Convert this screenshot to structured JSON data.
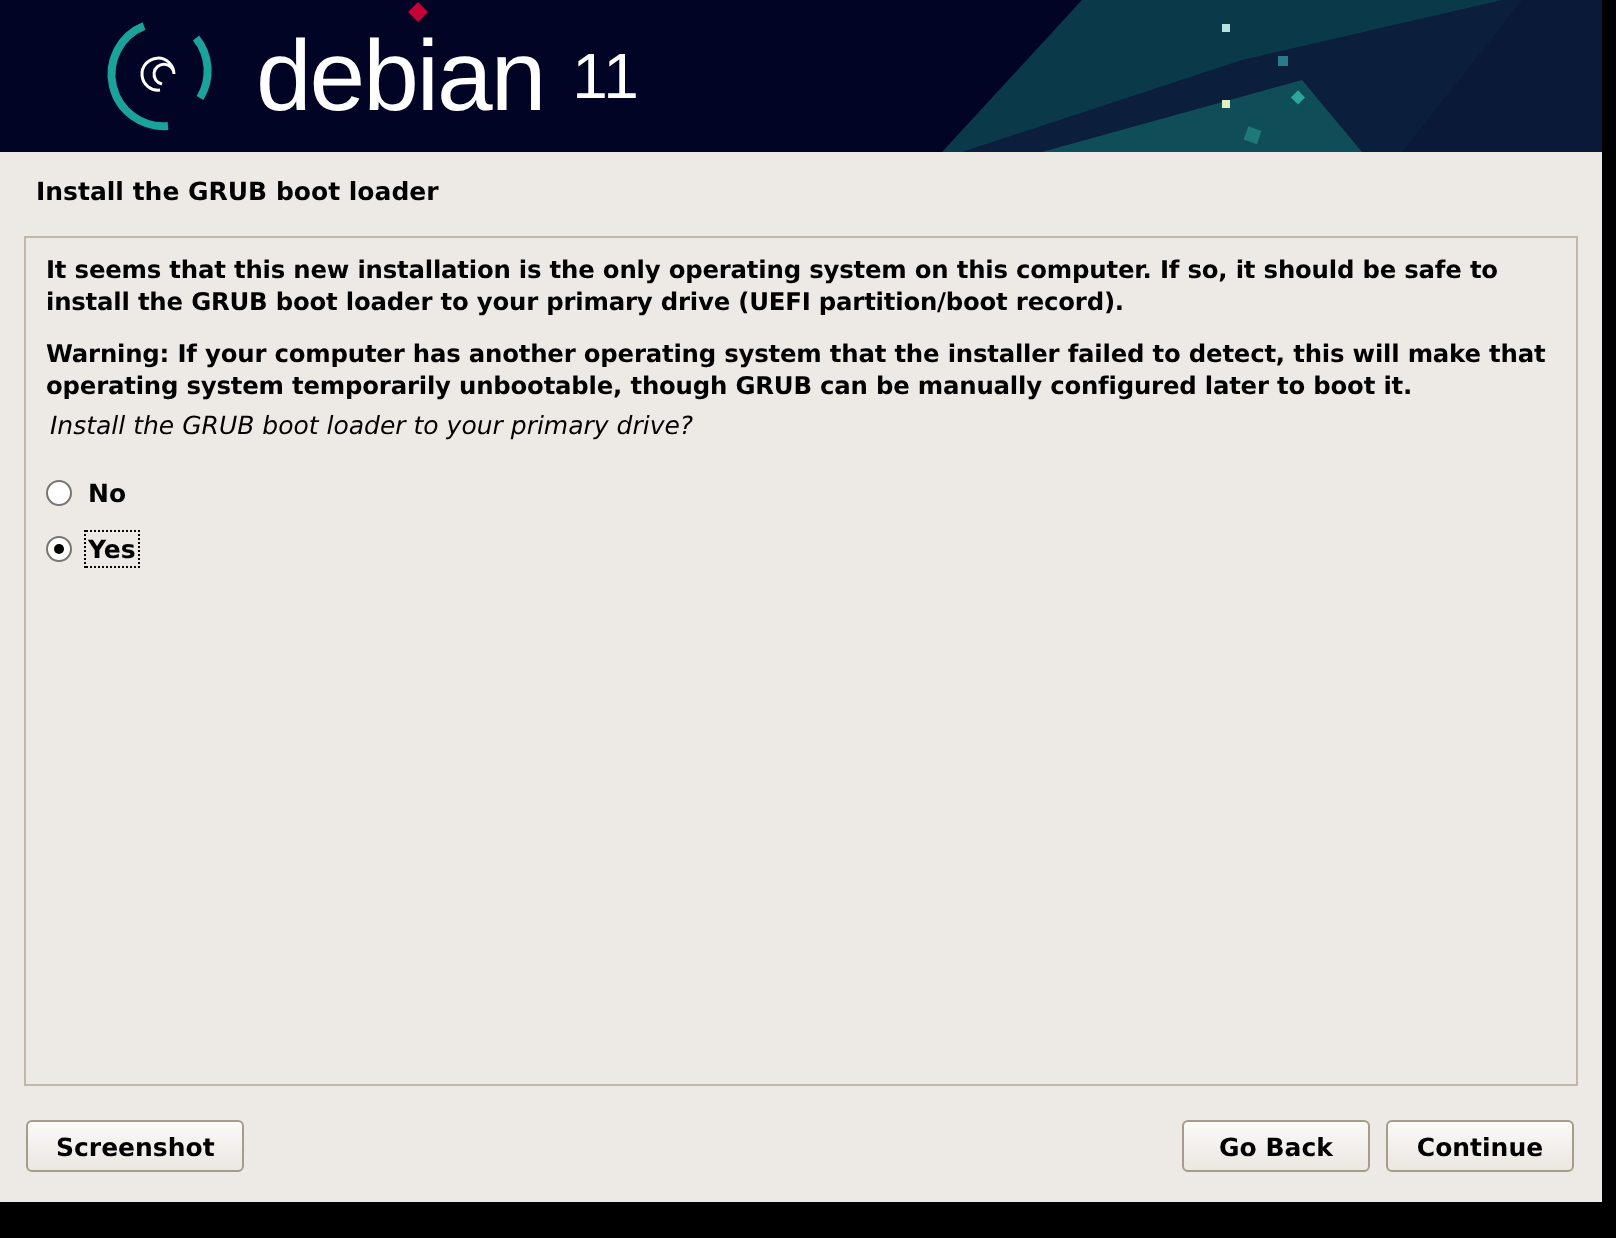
{
  "banner": {
    "logo_text": "debian",
    "version": "11"
  },
  "title": "Install the GRUB boot loader",
  "paragraphs": [
    "It seems that this new installation is the only operating system on this computer. If so, it should be safe to install the GRUB boot loader to your primary drive (UEFI partition/boot record).",
    "Warning: If your computer has another operating system that the installer failed to detect, this will make that operating system temporarily unbootable, though GRUB can be manually configured later to boot it."
  ],
  "question": "Install the GRUB boot loader to your primary drive?",
  "options": [
    {
      "label": "No",
      "selected": false
    },
    {
      "label": "Yes",
      "selected": true
    }
  ],
  "buttons": {
    "left": [
      "Screenshot"
    ],
    "right": [
      "Go Back",
      "Continue"
    ]
  }
}
